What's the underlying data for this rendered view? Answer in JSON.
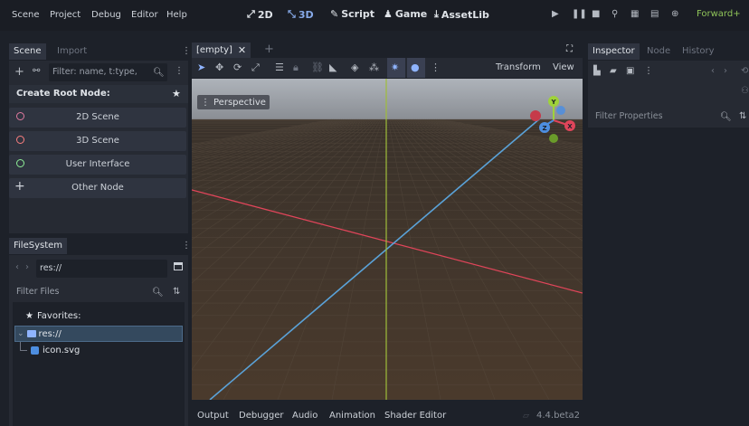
{
  "menu": [
    "Scene",
    "Project",
    "Debug",
    "Editor",
    "Help"
  ],
  "workspaces": [
    {
      "label": "2D",
      "icon": "⤢"
    },
    {
      "label": "3D",
      "icon": "⤡"
    },
    {
      "label": "Script",
      "icon": "✎"
    },
    {
      "label": "Game",
      "icon": "♟"
    },
    {
      "label": "AssetLib",
      "icon": "⤓"
    }
  ],
  "renderer": "Forward+",
  "left_dock": {
    "tabs": [
      "Scene",
      "Import"
    ],
    "filter_placeholder": "Filter: name, t:type,",
    "create_root_label": "Create Root Node:",
    "root_options": [
      {
        "label": "2D Scene",
        "color": "#e37aa0"
      },
      {
        "label": "3D Scene",
        "color": "#fc7f7f"
      },
      {
        "label": "User Interface",
        "color": "#8eef97"
      },
      {
        "label": "Other Node",
        "color": "#cdd2d9"
      }
    ]
  },
  "filesystem": {
    "tab": "FileSystem",
    "path": "res://",
    "filter_placeholder": "Filter Files",
    "favorites": "Favorites:",
    "root": "res://",
    "file": "icon.svg"
  },
  "editor": {
    "scene_tab": "[empty]",
    "transform_label": "Transform",
    "view_label": "View",
    "perspective_label": "Perspective",
    "gizmo": {
      "y": "Y",
      "x": "X",
      "z": "Z"
    }
  },
  "bottom": {
    "tabs": [
      "Output",
      "Debugger",
      "Audio",
      "Animation",
      "Shader Editor"
    ],
    "version": "4.4.beta2"
  },
  "inspector": {
    "tabs": [
      "Inspector",
      "Node",
      "History"
    ],
    "filter_placeholder": "Filter Properties"
  }
}
